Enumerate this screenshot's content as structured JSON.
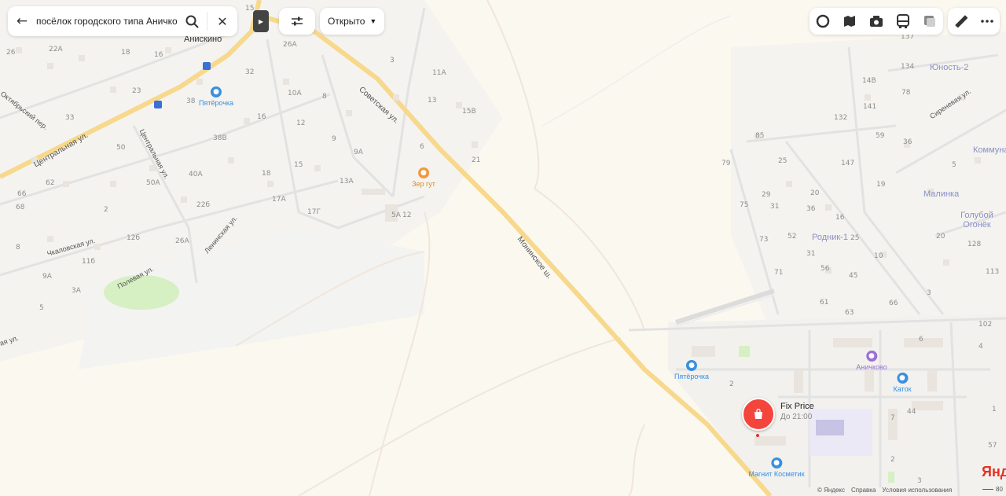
{
  "search": {
    "query": "посёлок городского типа Аничково",
    "back_icon": "arrow-left-icon",
    "search_icon": "search-icon",
    "close_icon": "close-icon"
  },
  "filters": {
    "icon": "sliders-icon",
    "open_now_label": "Открыто"
  },
  "toolbar_icons": [
    "traffic-icon",
    "panorama-icon",
    "camera-icon",
    "transit-icon",
    "layers-icon",
    "ruler-icon",
    "more-icon"
  ],
  "places": {
    "aniskino": "Анискино"
  },
  "districts": [
    "Юность-2",
    "Коммуна",
    "Малинка",
    "Голубой Огонёк",
    "Родник-1"
  ],
  "streets": {
    "central": "Центральная ул.",
    "sovetskaya": "Советская ул.",
    "monino": "Монинское ш.",
    "oktyabrsky": "Октябрьский пер.",
    "centralnaya_v": "Центральная ул.",
    "lenina": "Ленинская ул.",
    "chkalovskaya": "Чкаловская ул.",
    "polevaya": "Полевая ул.",
    "sirenevaya": "Сиреневая ул.",
    "edge": "ая ул."
  },
  "pois": [
    {
      "name": "Пятёрочка",
      "color": "#3a8fe0",
      "icon": "basket-icon"
    },
    {
      "name": "Зер гут",
      "color": "#f19a3e",
      "icon": "cafe-icon"
    },
    {
      "name": "Пятёрочка",
      "color": "#3a8fe0",
      "icon": "basket-icon"
    },
    {
      "name": "Аничково",
      "color": "#9b6fd6",
      "icon": "shop-icon"
    },
    {
      "name": "Каток",
      "color": "#3a8fe0",
      "icon": "skate-icon"
    },
    {
      "name": "Магнит Косметик",
      "color": "#3a8fe0",
      "icon": "cosmetics-icon"
    }
  ],
  "featured": {
    "name": "Fix Price",
    "hours": "До 21:00",
    "color": "#f4453d"
  },
  "house_numbers": [
    "26",
    "22А",
    "18",
    "16",
    "15",
    "26А",
    "32",
    "3",
    "11А",
    "10А",
    "8",
    "13",
    "38",
    "16",
    "12",
    "15В",
    "33",
    "23",
    "38В",
    "9",
    "6",
    "21",
    "50",
    "18",
    "40А",
    "15",
    "9А",
    "13А",
    "62",
    "50А",
    "66",
    "68",
    "2",
    "22б",
    "17А",
    "17Г",
    "5А",
    "12",
    "8",
    "26А",
    "11б",
    "12б",
    "3А",
    "9А",
    "5",
    "137",
    "134",
    "14В",
    "78",
    "141",
    "132",
    "59",
    "36",
    "85",
    "79",
    "25",
    "147",
    "5",
    "19",
    "29",
    "20",
    "75",
    "31",
    "36",
    "16",
    "73",
    "52",
    "25",
    "31",
    "10",
    "71",
    "56",
    "45",
    "61",
    "66",
    "63",
    "3",
    "102",
    "128",
    "20",
    "113",
    "6",
    "4",
    "2",
    "44",
    "7",
    "57",
    "2",
    "3",
    "1"
  ],
  "footer": {
    "copyright": "© Яндекс",
    "help": "Справка",
    "terms": "Условия использования",
    "scale": "80",
    "logo": "Янде"
  }
}
